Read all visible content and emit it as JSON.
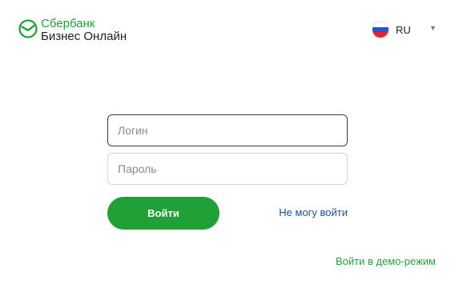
{
  "header": {
    "brand": "Сбербанк",
    "product": "Бизнес Онлайн",
    "language": {
      "code": "RU",
      "flag_icon": "russia-flag-icon",
      "caret_icon": "chevron-down-icon"
    }
  },
  "form": {
    "login_placeholder": "Логин",
    "login_value": "",
    "password_placeholder": "Пароль",
    "password_value": "",
    "submit_label": "Войти",
    "cant_login_label": "Не могу войти"
  },
  "footer": {
    "demo_label": "Войти в демо-режим"
  },
  "colors": {
    "brand_green": "#21a038",
    "link_blue": "#1b4f91"
  }
}
